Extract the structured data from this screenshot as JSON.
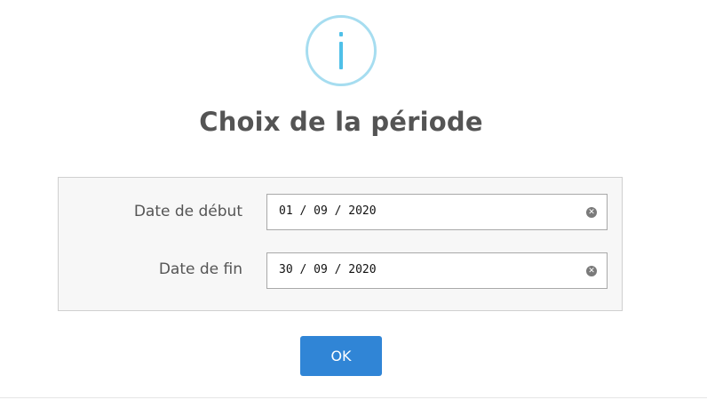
{
  "dialog": {
    "icon": "info-icon",
    "icon_color": "#4fc0e8",
    "icon_border_color": "#a6ddf0",
    "title": "Choix de la période"
  },
  "form": {
    "start": {
      "label": "Date de début",
      "value": "01 / 09 / 2020",
      "clear_icon": "clear-icon"
    },
    "end": {
      "label": "Date de fin",
      "value": "30 / 09 / 2020",
      "clear_icon": "clear-icon"
    }
  },
  "actions": {
    "ok_label": "OK",
    "ok_color": "#3085d6"
  }
}
